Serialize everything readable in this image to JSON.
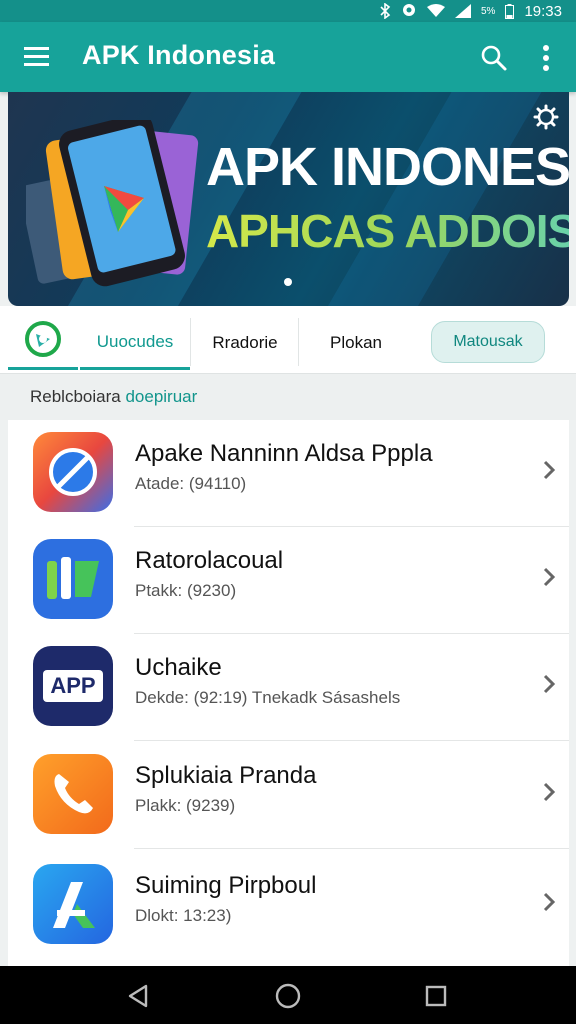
{
  "status_bar": {
    "time": "19:33",
    "battery_text": "5%"
  },
  "app_bar": {
    "title": "APK Indonesia"
  },
  "banner": {
    "headline": "APK INDONESI",
    "subline": "APHCAS ADDOISIA"
  },
  "tabs": [
    {
      "label": "Uuocudes"
    },
    {
      "label": "Rradorie"
    },
    {
      "label": "Plokan"
    },
    {
      "label": "Matousak"
    }
  ],
  "section": {
    "prefix": "Reblcboiara ",
    "accent": "doepiruar"
  },
  "apps": [
    {
      "name": "Apake Nanninn Aldsa Pppla",
      "meta": "Atade: (94110)"
    },
    {
      "name": "Ratorolacoual",
      "meta": "Ptakk: (9230)"
    },
    {
      "name": "Uchaike",
      "meta": "Dekde: (92:19) Tnekadk Sásashels",
      "icon_text": "APP"
    },
    {
      "name": "Splukiaia Pranda",
      "meta": "Plakk: (9239)"
    },
    {
      "name": "Suiming Pirpboul",
      "meta": "Dlokt: 13:23)"
    }
  ],
  "colors": {
    "primary": "#17a39a",
    "accent_text": "#12958c",
    "app_icon_1": "#e8473f",
    "app_icon_2": "#2d6fe0",
    "app_icon_3": "#1e2a6a",
    "app_icon_4": "#f57820",
    "app_icon_5": "#2486e8"
  }
}
